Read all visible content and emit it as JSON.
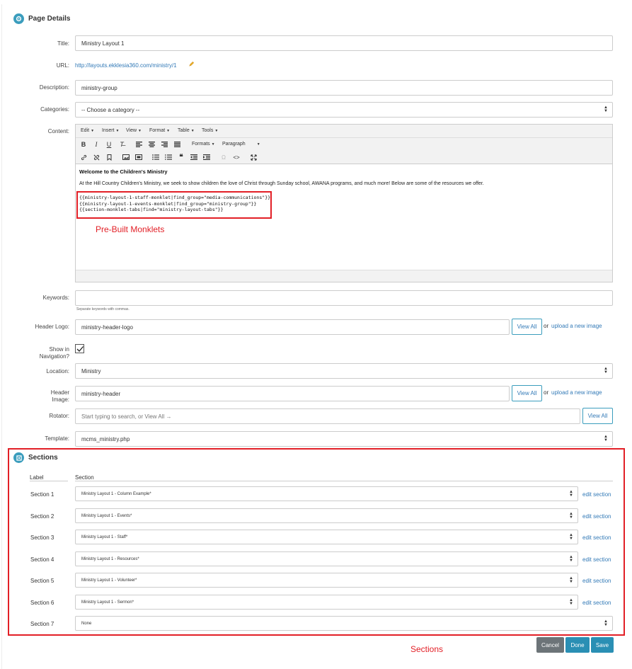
{
  "page_details": {
    "title": "Page Details",
    "fields": {
      "title_label": "Title:",
      "title_value": "Ministry Layout 1",
      "url_label": "URL:",
      "url_value": "http://layouts.ekklesia360.com/ministry/1",
      "description_label": "Description:",
      "description_value": "ministry-group",
      "categories_label": "Categories:",
      "categories_value": "-- Choose a category --",
      "content_label": "Content:",
      "keywords_label": "Keywords:",
      "keywords_help": "Separate keywords with commas.",
      "header_logo_label": "Header Logo:",
      "header_logo_value": "ministry-header-logo",
      "view_all": "View All",
      "or_text": "or",
      "upload_link": "upload a new image",
      "show_nav_label_1": "Show in",
      "show_nav_label_2": "Navigation?",
      "show_nav_checked": true,
      "location_label": "Location:",
      "location_value": "Ministry",
      "header_image_label_1": "Header",
      "header_image_label_2": "Image:",
      "header_image_value": "ministry-header",
      "rotator_label": "Rotator:",
      "rotator_placeholder": "Start typing to search, or View All →",
      "template_label": "Template:",
      "template_value": "mcms_ministry.php"
    }
  },
  "editor": {
    "menus": [
      "Edit",
      "Insert",
      "View",
      "Format",
      "Table",
      "Tools"
    ],
    "formats_label": "Formats",
    "paragraph_label": "Paragraph",
    "heading": "Welcome to the Children's Ministry",
    "paragraph": "At the Hill Country Children's Ministry, we seek to show children the love of Christ through Sunday school, AWANA programs, and much more! Below are some of the resources we offer.",
    "code_lines": [
      "{{ministry-layout-1-staff-monklet|find_group=\"media-communications\"}}",
      "{{ministry-layout-1-events-monklet|find_group=\"ministry-group\"}}",
      "{{section-monklet-tabs|find=\"ministry-layout-tabs\"}}"
    ]
  },
  "annotations": {
    "prebuilt": "Pre-Built Monklets",
    "sections": "Sections",
    "color": "#e21f26"
  },
  "sections": {
    "title": "Sections",
    "label_header": "Label",
    "section_header": "Section",
    "edit_text": "edit section",
    "rows": [
      {
        "label": "Section 1",
        "value": "Ministry Layout 1 - Column Example*",
        "editable": true
      },
      {
        "label": "Section 2",
        "value": "Ministry Layout 1 - Events*",
        "editable": true
      },
      {
        "label": "Section 3",
        "value": "Ministry Layout 1 - Staff*",
        "editable": true
      },
      {
        "label": "Section 4",
        "value": "Ministry Layout 1 - Resources*",
        "editable": true
      },
      {
        "label": "Section 5",
        "value": "Ministry Layout 1 - Volunteer*",
        "editable": true
      },
      {
        "label": "Section 6",
        "value": "Ministry Layout 1 - Sermon*",
        "editable": true
      },
      {
        "label": "Section 7",
        "value": "None",
        "editable": false
      }
    ]
  },
  "actions": {
    "cancel": "Cancel",
    "done": "Done",
    "save": "Save"
  },
  "colors": {
    "accent": "#3b9dbd",
    "link": "#337ab7",
    "cancel_bg": "#6c7478",
    "done_bg": "#2a8fb4",
    "save_bg": "#2a8fb4"
  }
}
